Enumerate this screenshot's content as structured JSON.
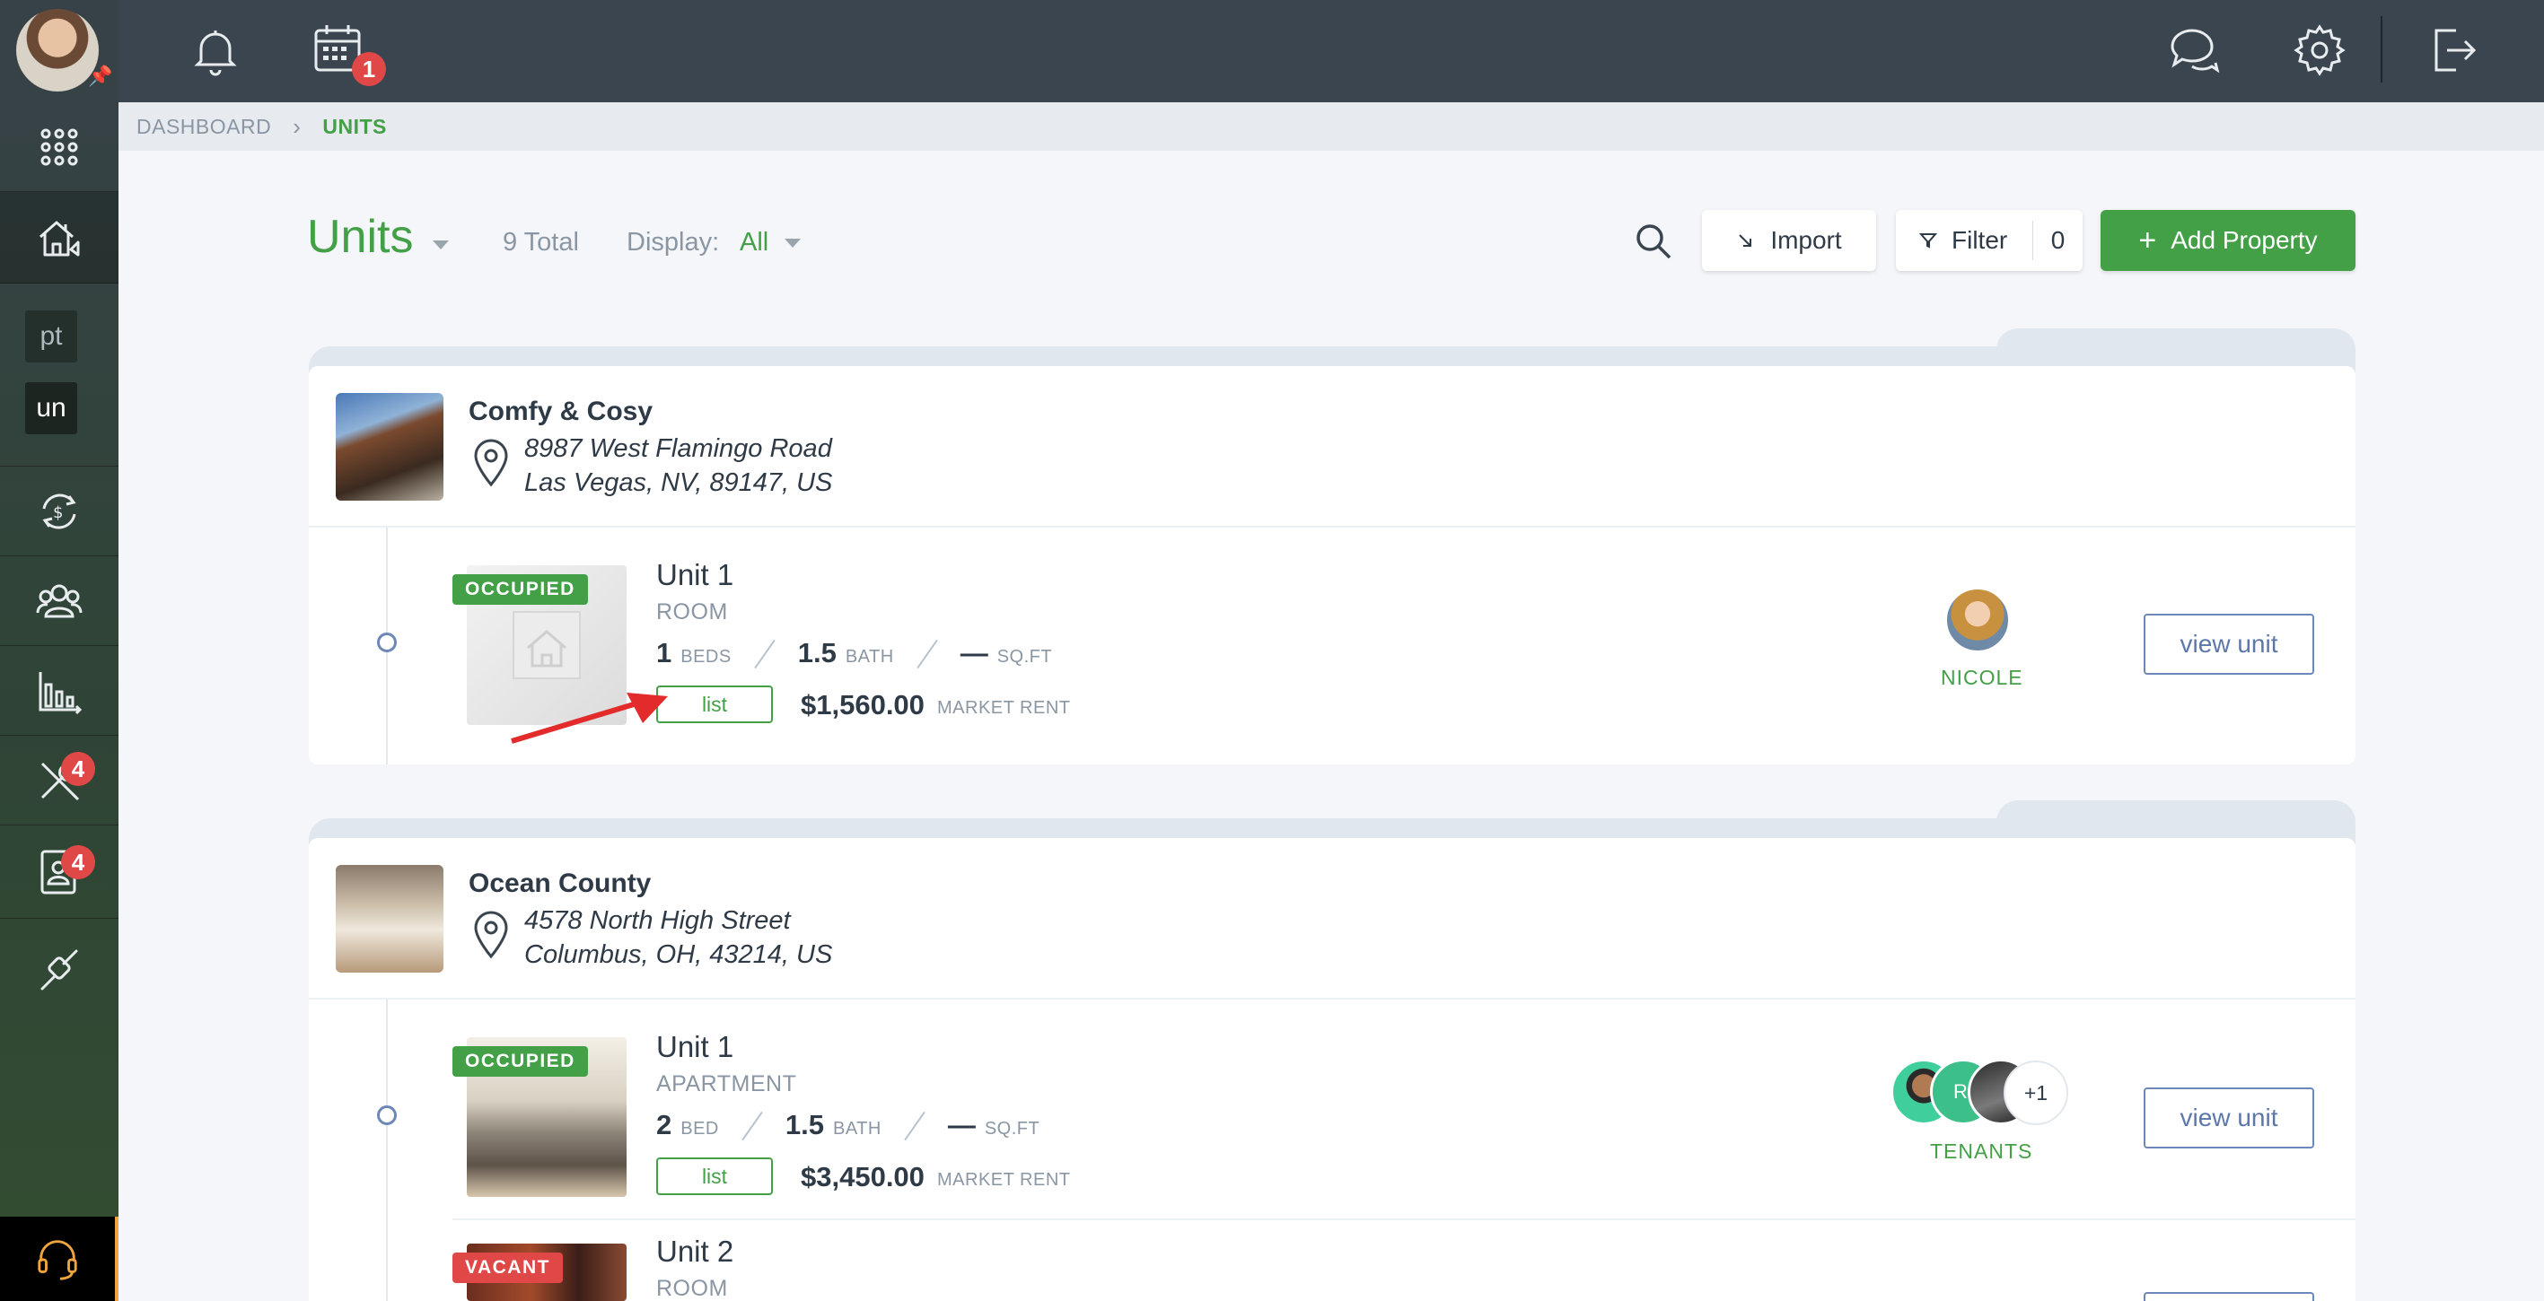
{
  "colors": {
    "accent": "#43a047",
    "danger": "#e04848",
    "topbar": "#3a454f"
  },
  "sidebar": {
    "tags": [
      "pt",
      "un"
    ],
    "badges": {
      "maintenance": "4",
      "leases": "4"
    },
    "icons": [
      "apps-grid-icon",
      "property-house-icon",
      "money-transfer-icon",
      "people-icon",
      "reports-chart-icon",
      "tools-icon",
      "contact-card-icon",
      "link-icon",
      "headset-icon"
    ]
  },
  "topbar": {
    "calendar_badge": "1"
  },
  "breadcrumb": {
    "home": "DASHBOARD",
    "current": "UNITS"
  },
  "header": {
    "title": "Units",
    "total": "9 Total",
    "display_label": "Display:",
    "display_value": "All",
    "import_label": "Import",
    "filter_label": "Filter",
    "filter_count": "0",
    "add_label": "Add Property"
  },
  "properties": [
    {
      "name": "Comfy & Cosy",
      "address_line1": "8987 West Flamingo Road",
      "address_line2": "Las Vegas, NV, 89147, US",
      "units": [
        {
          "status": "OCCUPIED",
          "name": "Unit 1",
          "type": "ROOM",
          "beds": "1",
          "beds_label": "BEDS",
          "baths": "1.5",
          "baths_label": "BATH",
          "sqft": "—",
          "sqft_label": "SQ.FT",
          "list_label": "list",
          "rent": "$1,560.00",
          "rent_label": "MARKET RENT",
          "tenant_label": "NICOLE",
          "view_label": "view unit"
        }
      ]
    },
    {
      "name": "Ocean County",
      "address_line1": "4578 North High Street",
      "address_line2": "Columbus, OH, 43214, US",
      "units": [
        {
          "status": "OCCUPIED",
          "name": "Unit 1",
          "type": "APARTMENT",
          "beds": "2",
          "beds_label": "BED",
          "baths": "1.5",
          "baths_label": "BATH",
          "sqft": "—",
          "sqft_label": "SQ.FT",
          "list_label": "list",
          "rent": "$3,450.00",
          "rent_label": "MARKET RENT",
          "tenant_initials": "RI",
          "tenant_more": "+1",
          "tenant_label": "TENANTS",
          "view_label": "view unit"
        },
        {
          "status": "VACANT",
          "name": "Unit 2",
          "type": "ROOM"
        }
      ]
    }
  ]
}
